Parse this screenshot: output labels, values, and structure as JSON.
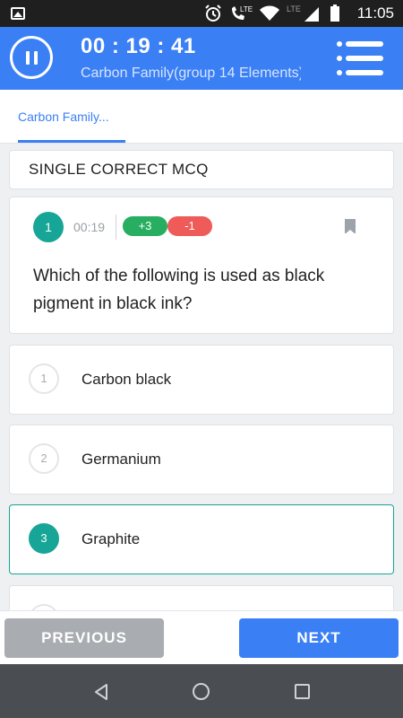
{
  "status_bar": {
    "time": "11:05",
    "network_label": "LTE",
    "call_label": "LTE"
  },
  "header": {
    "timer": "00 : 19 : 41",
    "subtitle": "Carbon Family(group 14 Elements)"
  },
  "tabs": [
    {
      "label": "Carbon Family...",
      "active": true
    }
  ],
  "section": {
    "title": "SINGLE CORRECT MCQ"
  },
  "question": {
    "number": "1",
    "time": "00:19",
    "positive_marks": "+3",
    "negative_marks": "-1",
    "text": "Which of the following is used as black pigment in black ink?"
  },
  "options": [
    {
      "number": "1",
      "label": "Carbon black",
      "selected": false
    },
    {
      "number": "2",
      "label": "Germanium",
      "selected": false
    },
    {
      "number": "3",
      "label": "Graphite",
      "selected": true
    }
  ],
  "actions": {
    "previous_label": "PREVIOUS",
    "next_label": "NEXT"
  },
  "colors": {
    "primary": "#3b7ff5",
    "accent_teal": "#16a596",
    "positive": "#27ae60",
    "negative": "#ee5b58",
    "disabled": "#a9acb0"
  },
  "icons": {
    "pause": "pause-icon",
    "menu": "menu-icon",
    "bookmark": "bookmark-icon",
    "back": "back-icon",
    "home": "home-icon",
    "recent": "recent-apps-icon"
  }
}
